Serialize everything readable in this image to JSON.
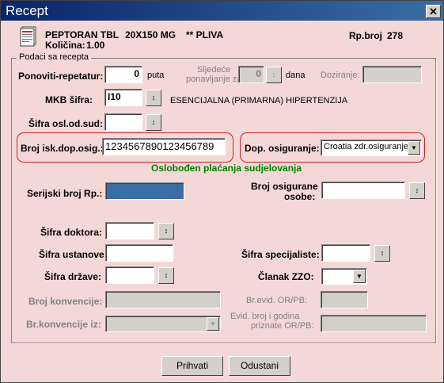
{
  "window": {
    "title": "Recept",
    "close_glyph": "✕"
  },
  "drug": {
    "name": "PEPTORAN TBL",
    "dose": "20X150 MG",
    "maker": "** PLIVA",
    "quantity_label": "Količina:",
    "quantity": "1.00",
    "rp_label": "Rp.broj",
    "rp_number": "278"
  },
  "group": {
    "label": "Podaci sa recepta"
  },
  "repeat": {
    "label": "Ponoviti-repetatur:",
    "value": "0",
    "unit": "puta",
    "next_label_1": "Sljedeće",
    "next_label_2": "ponavljanje za:",
    "next_value": "0",
    "next_unit": "dana",
    "dosing_label": "Doziranje:",
    "dosing_value": ""
  },
  "mkb": {
    "label": "MKB šifra:",
    "value": "I10",
    "description": "ESENCIJALNA (PRIMARNA) HIPERTENZIJA"
  },
  "court": {
    "label": "Šifra osl.od.sud:",
    "value": ""
  },
  "extra_ins": {
    "label": "Broj isk.dop.osig.:",
    "value": "1234567890123456789",
    "dop_label": "Dop. osiguranje:",
    "dop_value": "Croatia zdr.osiguranje",
    "exempt_note": "Oslobođen plaćanja sudjelovanja"
  },
  "serial": {
    "label": "Serijski broj Rp.:",
    "value": ""
  },
  "insured": {
    "label_1": "Broj osigurane",
    "label_2": "osobe:",
    "value": ""
  },
  "doctor": {
    "label": "Šifra doktora:",
    "value": ""
  },
  "institution": {
    "label": "Šifra ustanove:",
    "value": ""
  },
  "specialist": {
    "label": "Šifra specijaliste:",
    "value": ""
  },
  "country": {
    "label": "Šifra države:",
    "value": ""
  },
  "zzo": {
    "label": "Članak ZZO:",
    "value": ""
  },
  "convention": {
    "label": "Broj konvencije:",
    "value": "",
    "from_label": "Br.konvencije iz:",
    "from_value": ""
  },
  "evid": {
    "label": "Br.evid. OR/PB:",
    "value": "",
    "year_label_1": "Evid. broj i godina",
    "year_label_2": "priznate OR/PB:",
    "year_value": ""
  },
  "buttons": {
    "accept": "Prihvati",
    "cancel": "Odustani"
  },
  "icons": {
    "lookup": "spinner-updown-icon",
    "dropdown": "chevron-down-icon",
    "document": "document-stack-icon",
    "lookup_glyph": "↕",
    "dropdown_glyph": "▼"
  }
}
